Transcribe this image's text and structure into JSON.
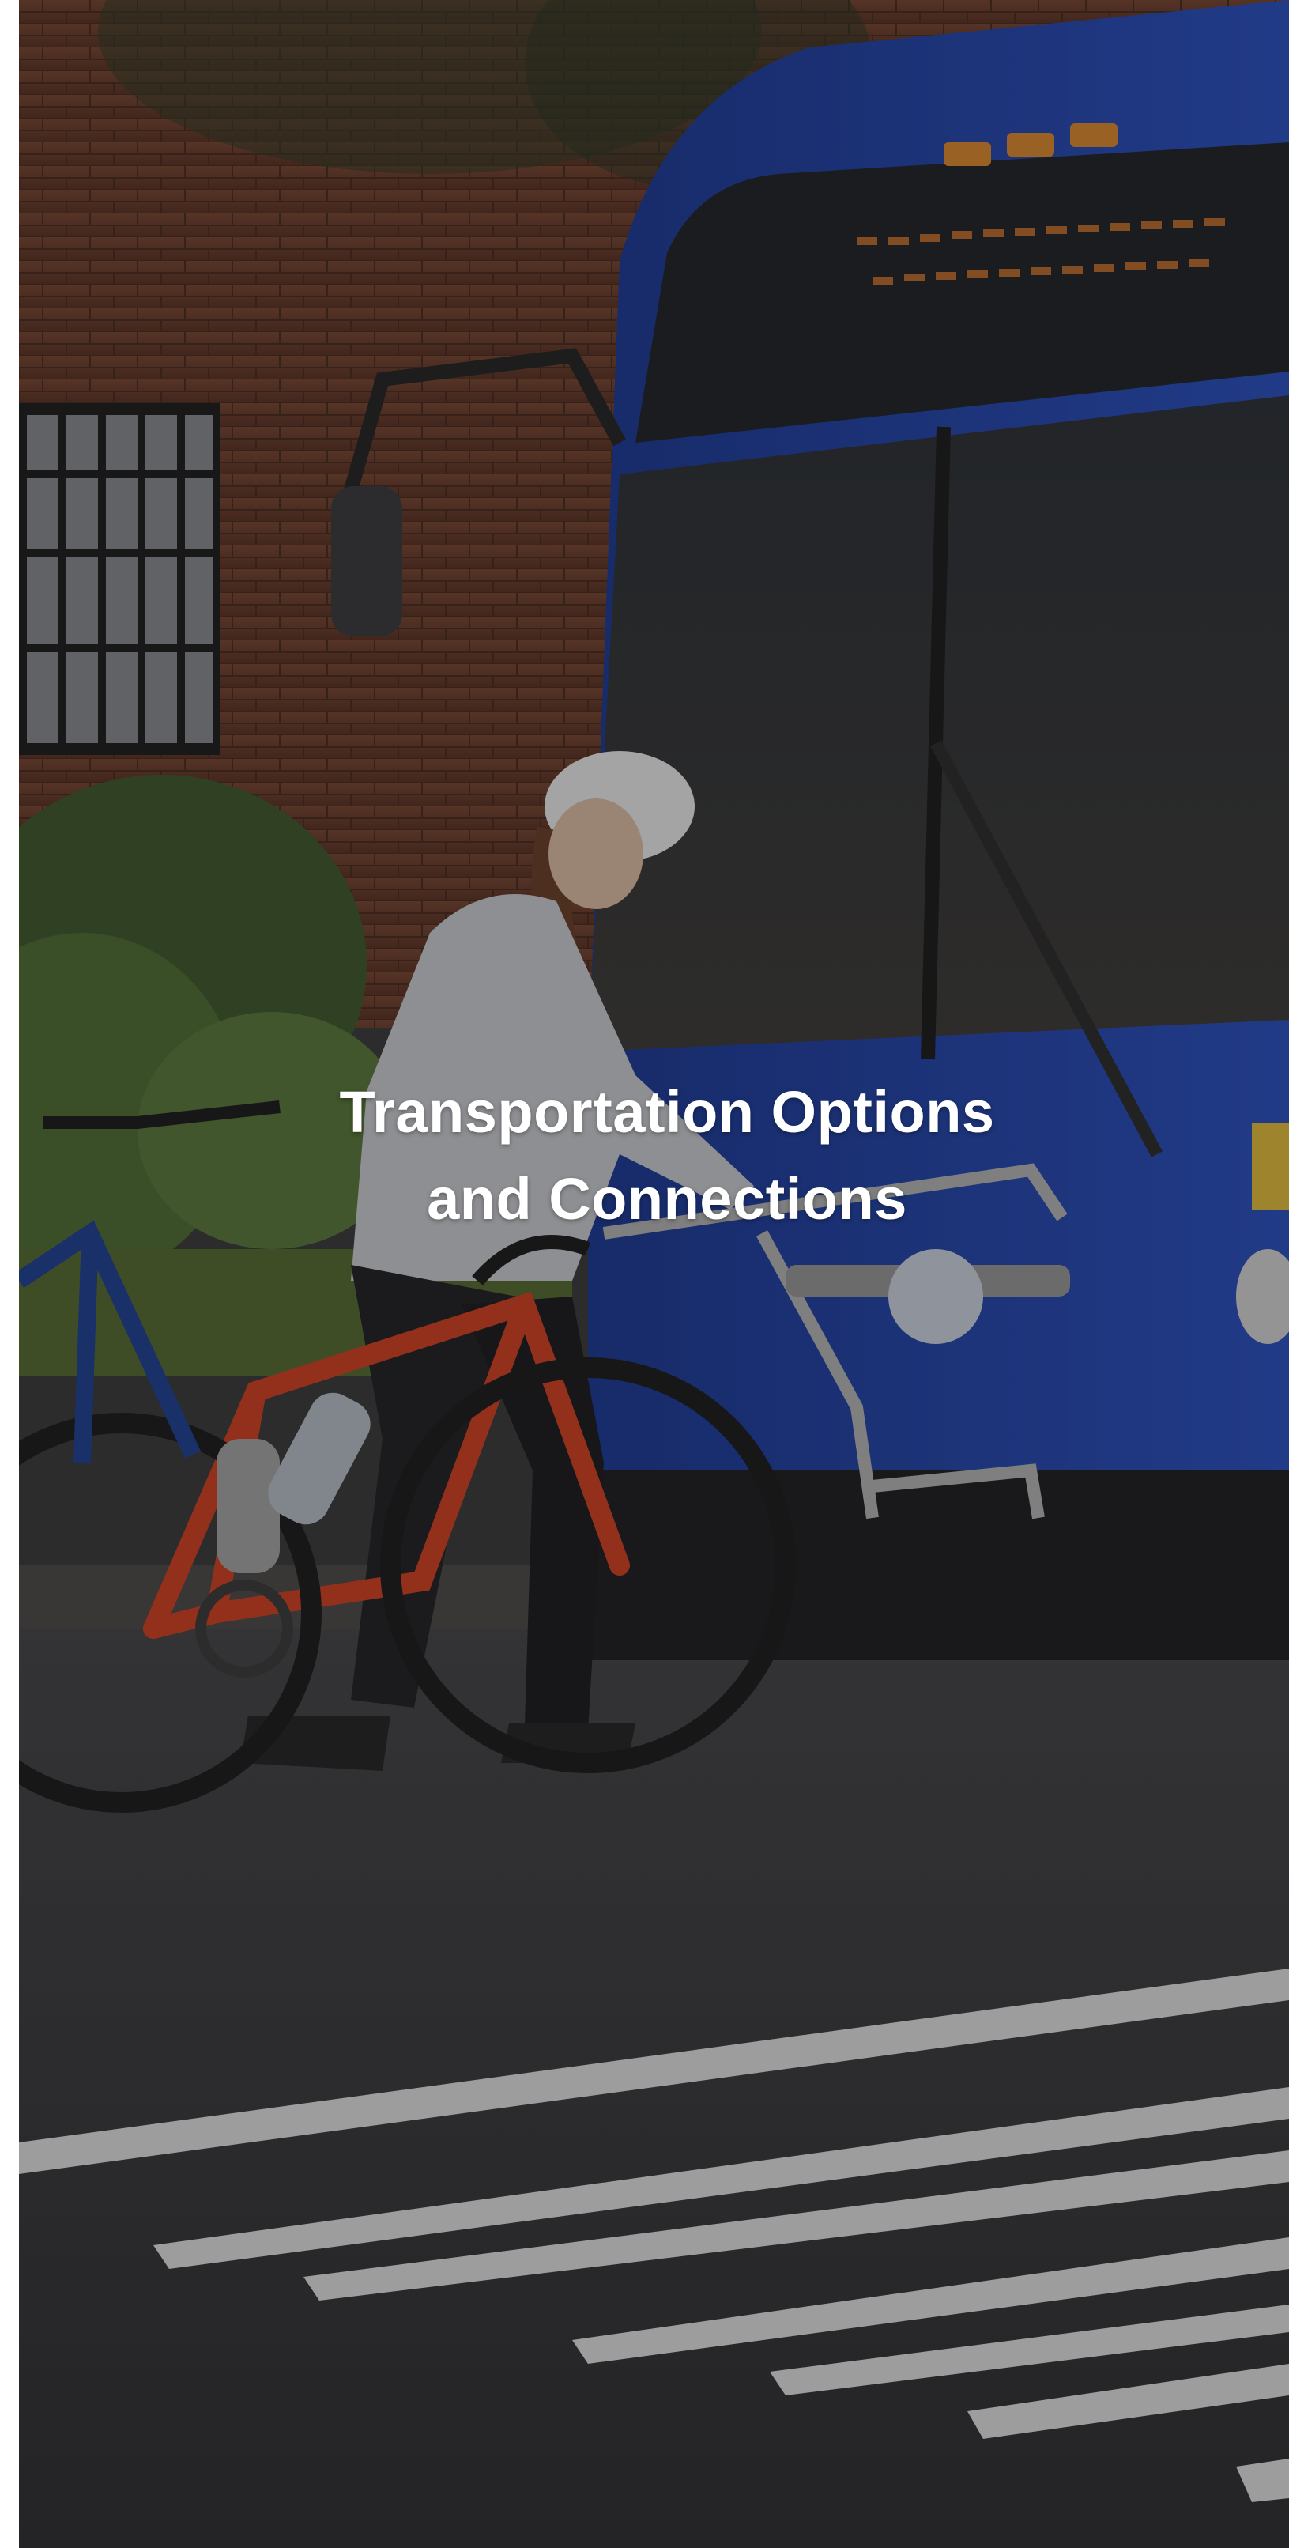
{
  "hero": {
    "title_line_1": "Transportation Options",
    "title_line_2": "and Connections",
    "image_alt": "Cyclist loading an orange bicycle onto the front bike rack of a blue transit bus",
    "colors": {
      "bus_blue": "#1f3fa8",
      "bike_orange": "#d8401f",
      "brick": "#6b3a26",
      "asphalt": "#3b3b3d",
      "title_text": "#ffffff"
    }
  }
}
